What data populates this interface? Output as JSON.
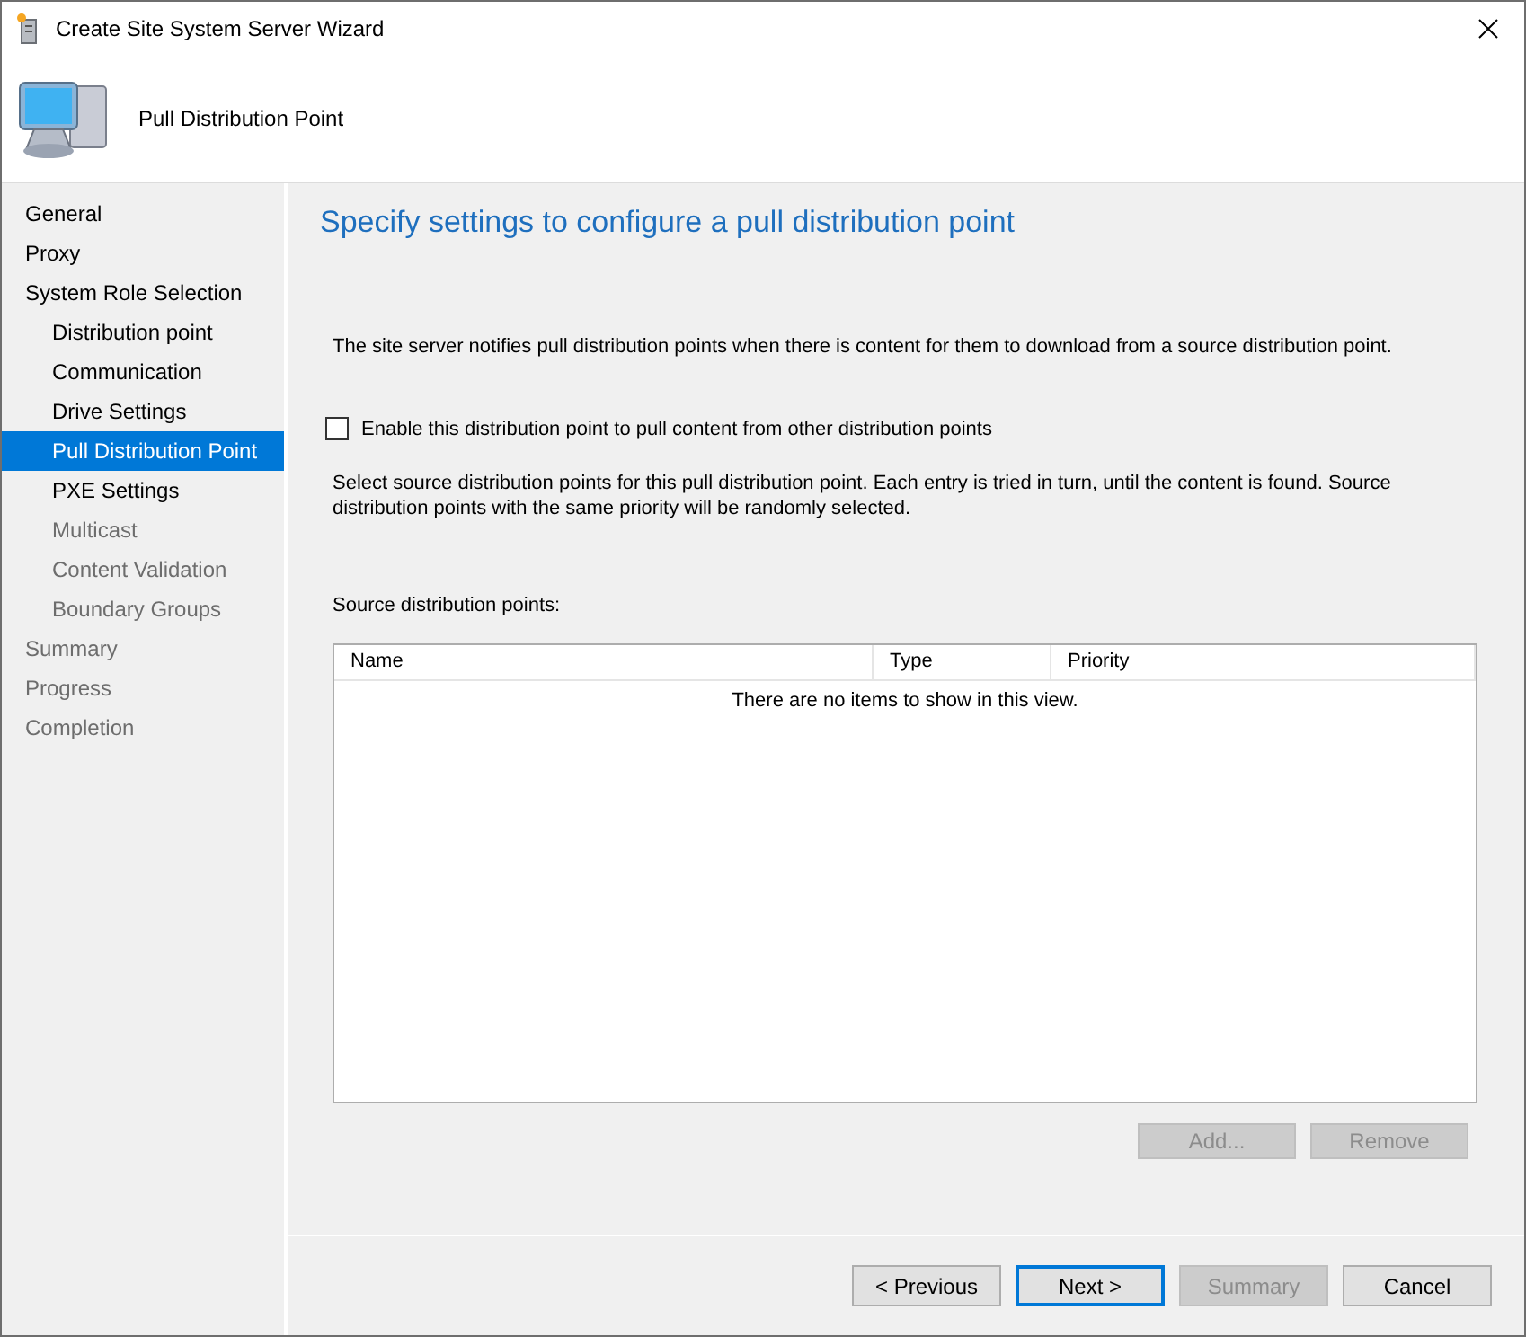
{
  "window": {
    "title": "Create Site System Server Wizard"
  },
  "header": {
    "title": "Pull Distribution Point"
  },
  "nav": [
    {
      "label": "General",
      "selected": false,
      "disabled": false
    },
    {
      "label": "Proxy",
      "selected": false,
      "disabled": false
    },
    {
      "label": "System Role Selection",
      "selected": false,
      "disabled": false,
      "children": [
        {
          "label": "Distribution point",
          "selected": false,
          "disabled": false
        },
        {
          "label": "Communication",
          "selected": false,
          "disabled": false
        },
        {
          "label": "Drive Settings",
          "selected": false,
          "disabled": false
        },
        {
          "label": "Pull Distribution Point",
          "selected": true,
          "disabled": false
        },
        {
          "label": "PXE Settings",
          "selected": false,
          "disabled": false
        },
        {
          "label": "Multicast",
          "selected": false,
          "disabled": true
        },
        {
          "label": "Content Validation",
          "selected": false,
          "disabled": true
        },
        {
          "label": "Boundary Groups",
          "selected": false,
          "disabled": true
        }
      ]
    },
    {
      "label": "Summary",
      "selected": false,
      "disabled": true
    },
    {
      "label": "Progress",
      "selected": false,
      "disabled": true
    },
    {
      "label": "Completion",
      "selected": false,
      "disabled": true
    }
  ],
  "page": {
    "heading": "Specify settings to configure a pull distribution point",
    "intro": "The site server notifies pull distribution points when there is content for them to download from a source distribution point.",
    "checkbox": {
      "label": "Enable this distribution point to pull content from other distribution points",
      "checked": false
    },
    "description": "Select source distribution points for this pull distribution point. Each entry is tried in turn, until the content is found. Source distribution points with the same priority will be randomly selected.",
    "list_label": "Source distribution points:",
    "table": {
      "columns": [
        "Name",
        "Type",
        "Priority"
      ],
      "empty_text": "There are no items to show in this view."
    },
    "list_buttons": [
      {
        "label": "Add...",
        "disabled": true
      },
      {
        "label": "Remove",
        "disabled": true
      }
    ]
  },
  "buttons": [
    {
      "label": "< Previous",
      "disabled": false,
      "default": false
    },
    {
      "label": "Next >",
      "disabled": false,
      "default": true
    },
    {
      "label": "Summary",
      "disabled": true,
      "default": false
    },
    {
      "label": "Cancel",
      "disabled": false,
      "default": false
    }
  ]
}
